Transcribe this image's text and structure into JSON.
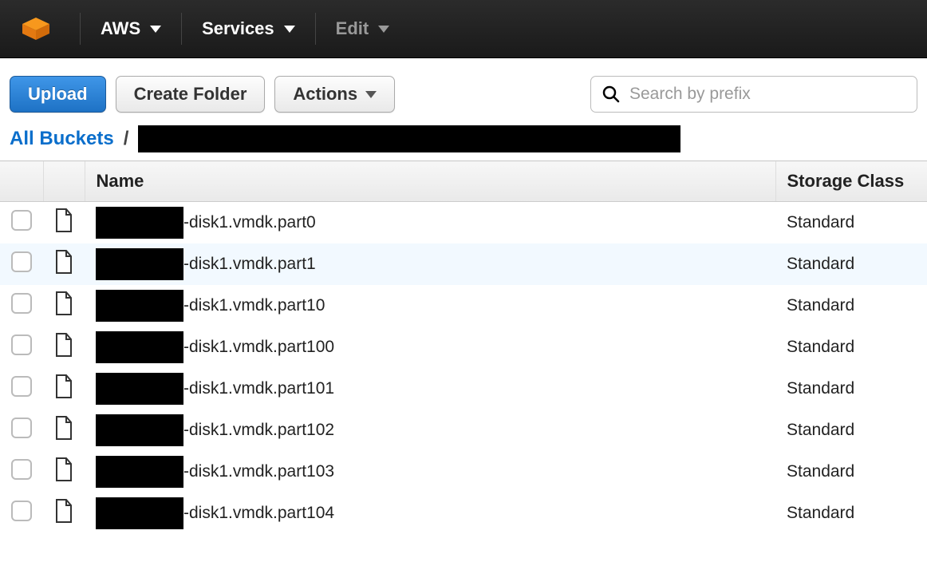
{
  "topnav": {
    "aws_label": "AWS",
    "services_label": "Services",
    "edit_label": "Edit"
  },
  "toolbar": {
    "upload_label": "Upload",
    "create_folder_label": "Create Folder",
    "actions_label": "Actions"
  },
  "search": {
    "placeholder": "Search by prefix"
  },
  "breadcrumb": {
    "root_label": "All Buckets",
    "separator": "/"
  },
  "table": {
    "headers": {
      "name": "Name",
      "storage_class": "Storage Class"
    },
    "rows": [
      {
        "name_suffix": "-disk1.vmdk.part0",
        "storage_class": "Standard",
        "highlight": false
      },
      {
        "name_suffix": "-disk1.vmdk.part1",
        "storage_class": "Standard",
        "highlight": true
      },
      {
        "name_suffix": "-disk1.vmdk.part10",
        "storage_class": "Standard",
        "highlight": false
      },
      {
        "name_suffix": "-disk1.vmdk.part100",
        "storage_class": "Standard",
        "highlight": false
      },
      {
        "name_suffix": "-disk1.vmdk.part101",
        "storage_class": "Standard",
        "highlight": false
      },
      {
        "name_suffix": "-disk1.vmdk.part102",
        "storage_class": "Standard",
        "highlight": false
      },
      {
        "name_suffix": "-disk1.vmdk.part103",
        "storage_class": "Standard",
        "highlight": false
      },
      {
        "name_suffix": "-disk1.vmdk.part104",
        "storage_class": "Standard",
        "highlight": false
      }
    ]
  }
}
